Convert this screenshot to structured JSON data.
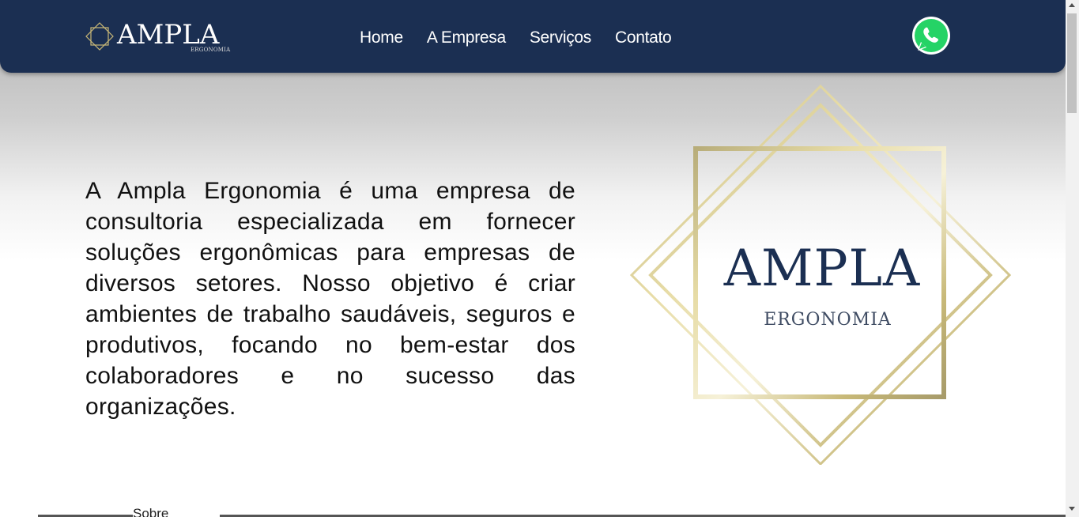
{
  "header": {
    "logo_word": "AMPLA",
    "logo_sub": "ERGONOMIA",
    "nav": [
      "Home",
      "A Empresa",
      "Serviços",
      "Contato"
    ],
    "whatsapp_icon": "whatsapp-icon"
  },
  "main": {
    "intro_text": "A Ampla Ergonomia é uma empresa de consultoria especializada em fornecer soluções ergonômicas para empresas de diversos setores. Nosso objetivo é criar ambientes de trabalho saudáveis, seguros e produtivos, focando no bem-estar dos colaboradores e no sucesso das organizações.",
    "hero_logo_word": "AMPLA",
    "hero_logo_sub": "ERGONOMIA",
    "about_link": "Sobre"
  },
  "colors": {
    "header_bg": "#1b2f52",
    "brand_navy": "#1b2f52",
    "gold": "#c9b877",
    "whatsapp_green": "#25d366"
  }
}
